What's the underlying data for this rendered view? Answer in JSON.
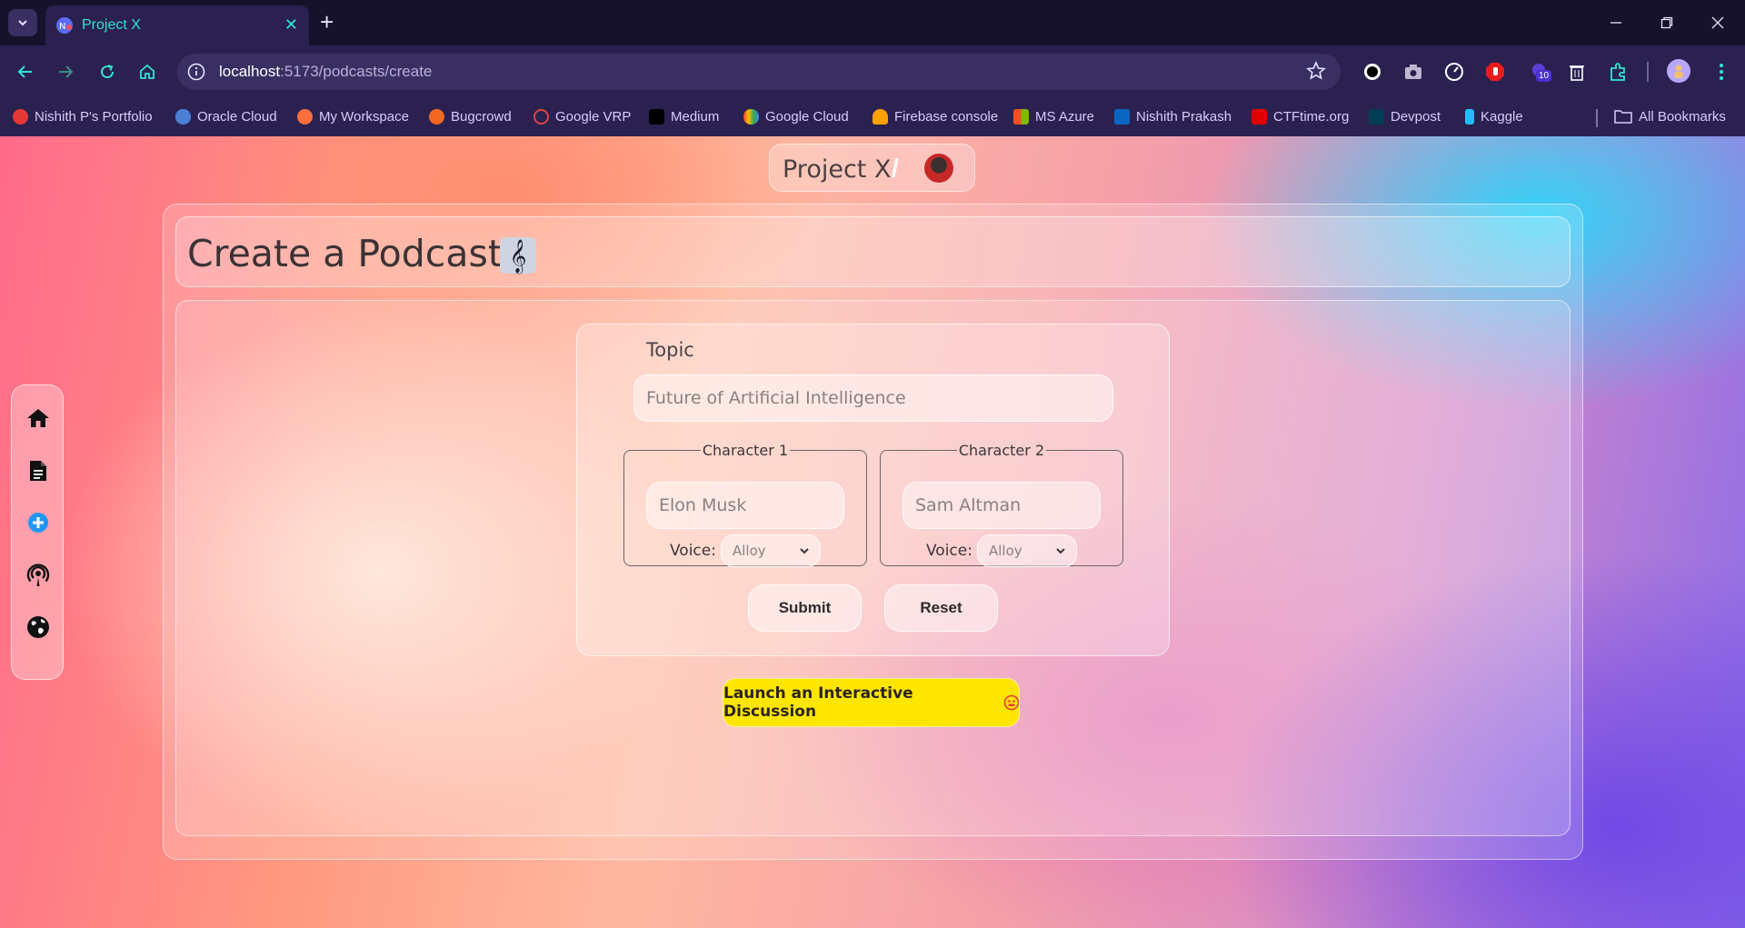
{
  "browser": {
    "tab_title": "Project X",
    "url_host": "localhost",
    "url_rest": ":5173/podcasts/create",
    "extension_badge": "10",
    "bookmarks": [
      {
        "label": "Nishith P's Portfolio",
        "color": "#e53935"
      },
      {
        "label": "Oracle Cloud",
        "color": "#4a7fd4"
      },
      {
        "label": "My Workspace",
        "color": "#ff6f3c"
      },
      {
        "label": "Bugcrowd",
        "color": "#f26822"
      },
      {
        "label": "Google VRP",
        "color": "#d44"
      },
      {
        "label": "Medium",
        "color": "#000000"
      },
      {
        "label": "Google Cloud",
        "color": "#4285f4"
      },
      {
        "label": "Firebase console",
        "color": "#ffa000"
      },
      {
        "label": "MS Azure",
        "color": "#00a4ef"
      },
      {
        "label": "Nishith Prakash",
        "color": "#0a66c2"
      },
      {
        "label": "CTFtime.org",
        "color": "#e00000"
      },
      {
        "label": "Devpost",
        "color": "#003e54"
      },
      {
        "label": "Kaggle",
        "color": "#20beff"
      }
    ],
    "all_bookmarks": "All Bookmarks"
  },
  "app": {
    "brand": "Project X",
    "separator": "/"
  },
  "header": {
    "title": "Create a Podcast",
    "title_emoji": "𝄞"
  },
  "form": {
    "topic_label": "Topic",
    "topic_placeholder": "Future of Artificial Intelligence",
    "character1": {
      "legend": "Character 1",
      "placeholder": "Elon Musk",
      "voice_label": "Voice:",
      "voice_value": "Alloy"
    },
    "character2": {
      "legend": "Character 2",
      "placeholder": "Sam Altman",
      "voice_label": "Voice:",
      "voice_value": "Alloy"
    },
    "submit_label": "Submit",
    "reset_label": "Reset"
  },
  "launch": {
    "label": "Launch an Interactive Discussion"
  },
  "sidebar": {
    "items": [
      "home-icon",
      "document-icon",
      "add-icon",
      "podcast-icon",
      "globe-icon"
    ]
  }
}
